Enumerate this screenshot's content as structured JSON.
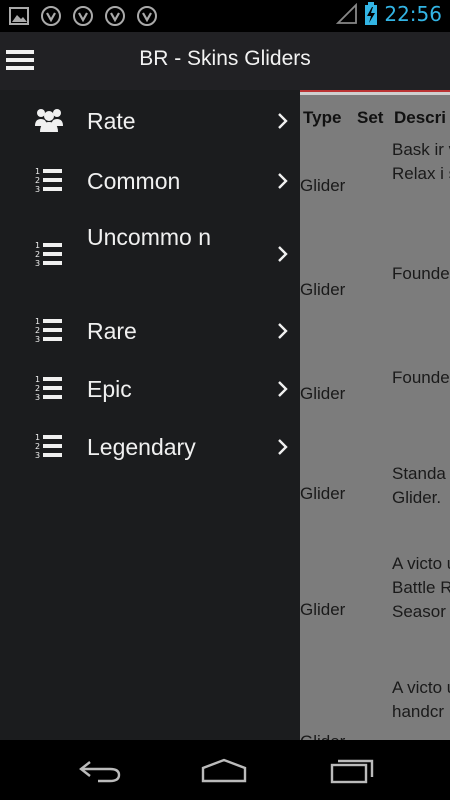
{
  "status_bar": {
    "time": "22:56",
    "left_icons": [
      "gallery-icon",
      "vpn-key-icon",
      "vpn-key-icon",
      "vpn-key-icon",
      "vpn-key-icon"
    ],
    "right_icons": [
      "signal-icon",
      "battery-charging-icon"
    ],
    "accent_color": "#33b5e5"
  },
  "app_bar": {
    "title": "BR - Skins Gliders"
  },
  "drawer": {
    "items": [
      {
        "label": "Rate",
        "icon": "people-icon"
      },
      {
        "label": "Common",
        "icon": "numbered-list-icon"
      },
      {
        "label": "Uncommo n",
        "icon": "numbered-list-icon"
      },
      {
        "label": "Rare",
        "icon": "numbered-list-icon"
      },
      {
        "label": "Epic",
        "icon": "numbered-list-icon"
      },
      {
        "label": "Legendary",
        "icon": "numbered-list-icon"
      }
    ]
  },
  "table": {
    "headers": [
      "Type",
      "Set",
      "Descri"
    ],
    "rows": [
      {
        "type": "Glider",
        "desc": "Bask ir victory Relax i shade."
      },
      {
        "type": "Glider",
        "desc": "Founde exclus"
      },
      {
        "type": "Glider",
        "desc": "Founde exclus"
      },
      {
        "type": "Glider",
        "desc": "Standa Battle Glider."
      },
      {
        "type": "Glider",
        "desc": "A victo umbre Battle Royale Seasor"
      },
      {
        "type": "Glider",
        "desc": "A victo umbre handcr"
      }
    ]
  },
  "nav_bar": {
    "buttons": [
      "back-icon",
      "home-icon",
      "recents-icon"
    ]
  }
}
